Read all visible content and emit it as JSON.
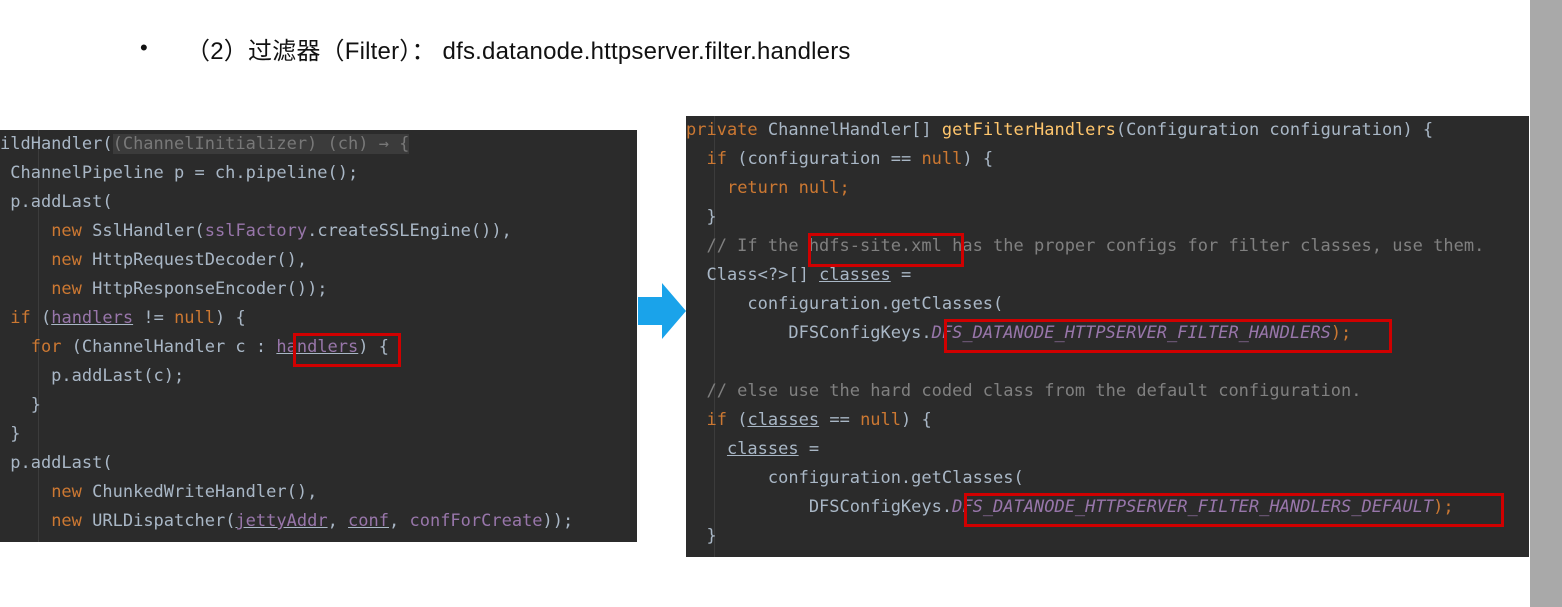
{
  "header": {
    "bullet": "•",
    "text": "（2）过滤器（Filter）：   dfs.datanode.httpserver.filter.handlers"
  },
  "left_code": {
    "lines": [
      [
        {
          "t": "ildHandler(",
          "c": "pl"
        },
        {
          "t": "(ChannelInitializer) (ch) → {",
          "c": "hint"
        }
      ],
      [
        {
          "t": " ChannelPipeline p = ch.pipeline();",
          "c": "pl"
        }
      ],
      [
        {
          "t": " p.addLast(",
          "c": "pl"
        }
      ],
      [
        {
          "t": "     ",
          "c": "pl"
        },
        {
          "t": "new ",
          "c": "kw"
        },
        {
          "t": "SslHandler(",
          "c": "pl"
        },
        {
          "t": "sslFactory",
          "c": "fld"
        },
        {
          "t": ".createSSLEngine()),",
          "c": "pl"
        }
      ],
      [
        {
          "t": "     ",
          "c": "pl"
        },
        {
          "t": "new ",
          "c": "kw"
        },
        {
          "t": "HttpRequestDecoder(),",
          "c": "pl"
        }
      ],
      [
        {
          "t": "     ",
          "c": "pl"
        },
        {
          "t": "new ",
          "c": "kw"
        },
        {
          "t": "HttpResponseEncoder());",
          "c": "pl"
        }
      ],
      [
        {
          "t": " ",
          "c": "pl"
        },
        {
          "t": "if ",
          "c": "kw"
        },
        {
          "t": "(",
          "c": "pl"
        },
        {
          "t": "handlers",
          "c": "fld ul"
        },
        {
          "t": " != ",
          "c": "pl"
        },
        {
          "t": "null",
          "c": "kw"
        },
        {
          "t": ") {",
          "c": "pl"
        }
      ],
      [
        {
          "t": "   ",
          "c": "pl"
        },
        {
          "t": "for ",
          "c": "kw"
        },
        {
          "t": "(ChannelHandler c : ",
          "c": "pl"
        },
        {
          "t": "handlers",
          "c": "fld ul"
        },
        {
          "t": ") {",
          "c": "pl"
        }
      ],
      [
        {
          "t": "     p.addLast(c);",
          "c": "pl"
        }
      ],
      [
        {
          "t": "   }",
          "c": "pl"
        }
      ],
      [
        {
          "t": " }",
          "c": "pl"
        }
      ],
      [
        {
          "t": " p.addLast(",
          "c": "pl"
        }
      ],
      [
        {
          "t": "     ",
          "c": "pl"
        },
        {
          "t": "new ",
          "c": "kw"
        },
        {
          "t": "ChunkedWriteHandler(),",
          "c": "pl"
        }
      ],
      [
        {
          "t": "     ",
          "c": "pl"
        },
        {
          "t": "new ",
          "c": "kw"
        },
        {
          "t": "URLDispatcher(",
          "c": "pl"
        },
        {
          "t": "jettyAddr",
          "c": "fld ul"
        },
        {
          "t": ", ",
          "c": "pl"
        },
        {
          "t": "conf",
          "c": "fld ul"
        },
        {
          "t": ", ",
          "c": "pl"
        },
        {
          "t": "confForCreate",
          "c": "fld"
        },
        {
          "t": "));",
          "c": "pl"
        }
      ]
    ]
  },
  "right_code": {
    "lines": [
      [
        {
          "t": "private ",
          "c": "kw"
        },
        {
          "t": "ChannelHandler[] ",
          "c": "pl"
        },
        {
          "t": "getFilterHandlers",
          "c": "fn"
        },
        {
          "t": "(Configuration configuration) {",
          "c": "pl"
        }
      ],
      [
        {
          "t": "  ",
          "c": "pl"
        },
        {
          "t": "if ",
          "c": "kw"
        },
        {
          "t": "(configuration == ",
          "c": "pl"
        },
        {
          "t": "null",
          "c": "kw"
        },
        {
          "t": ") {",
          "c": "pl"
        }
      ],
      [
        {
          "t": "    ",
          "c": "pl"
        },
        {
          "t": "return null;",
          "c": "kw"
        }
      ],
      [
        {
          "t": "  }",
          "c": "pl"
        }
      ],
      [
        {
          "t": "  // If the hdfs-site.xml has the proper configs for filter classes, use them.",
          "c": "cm"
        }
      ],
      [
        {
          "t": "  Class<?>[] ",
          "c": "pl"
        },
        {
          "t": "classes",
          "c": "pl ul"
        },
        {
          "t": " =",
          "c": "pl"
        }
      ],
      [
        {
          "t": "      configuration.getClasses(",
          "c": "pl"
        }
      ],
      [
        {
          "t": "          DFSConfigKeys.",
          "c": "pl"
        },
        {
          "t": "DFS_DATANODE_HTTPSERVER_FILTER_HANDLERS",
          "c": "it"
        },
        {
          "t": ");",
          "c": "kw"
        }
      ],
      [
        {
          "t": "",
          "c": "pl"
        }
      ],
      [
        {
          "t": "  // else use the hard coded class from the default configuration.",
          "c": "cm"
        }
      ],
      [
        {
          "t": "  ",
          "c": "pl"
        },
        {
          "t": "if ",
          "c": "kw"
        },
        {
          "t": "(",
          "c": "pl"
        },
        {
          "t": "classes",
          "c": "pl ul"
        },
        {
          "t": " == ",
          "c": "pl"
        },
        {
          "t": "null",
          "c": "kw"
        },
        {
          "t": ") {",
          "c": "pl"
        }
      ],
      [
        {
          "t": "    ",
          "c": "pl"
        },
        {
          "t": "classes",
          "c": "pl ul"
        },
        {
          "t": " =",
          "c": "pl"
        }
      ],
      [
        {
          "t": "        configuration.getClasses(",
          "c": "pl"
        }
      ],
      [
        {
          "t": "            DFSConfigKeys.",
          "c": "pl"
        },
        {
          "t": "DFS_DATANODE_HTTPSERVER_FILTER_HANDLERS_DEFAULT",
          "c": "it"
        },
        {
          "t": ");",
          "c": "kw"
        }
      ],
      [
        {
          "t": "  }",
          "c": "pl"
        }
      ]
    ]
  },
  "colors": {
    "highlight": "#d00000",
    "arrow": "#1aa3ea",
    "editor_bg": "#2b2b2b"
  }
}
